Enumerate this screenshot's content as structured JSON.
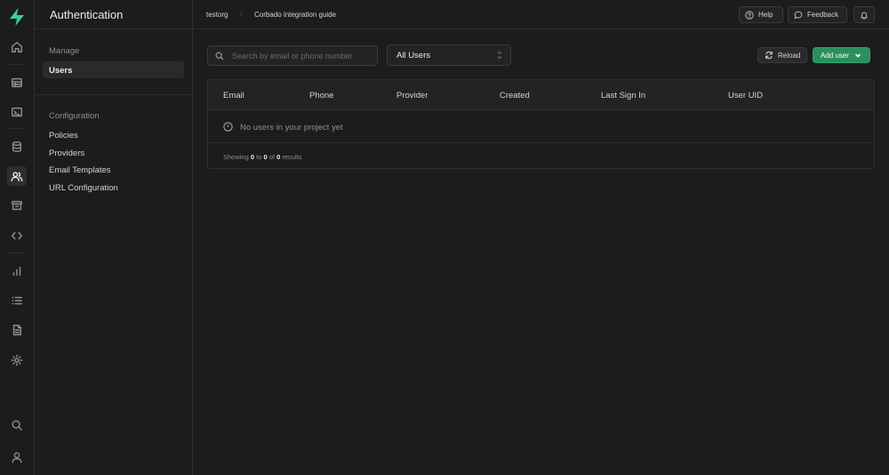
{
  "colors": {
    "brand": "#3ecf8e",
    "background": "#1c1c1c",
    "border": "#2e2e2e",
    "add_button": "#2b8f5e"
  },
  "rail": {
    "logo": "supabase-logo",
    "icons": [
      "home-icon",
      "table-editor-icon",
      "sql-editor-icon",
      "database-icon",
      "authentication-icon",
      "storage-icon",
      "edge-functions-icon",
      "reports-icon",
      "logs-icon",
      "api-docs-icon",
      "settings-icon",
      "search-icon",
      "user-icon"
    ],
    "active": "authentication-icon"
  },
  "menu": {
    "title": "Authentication",
    "sections": [
      {
        "title": "Manage",
        "items": [
          "Users"
        ]
      },
      {
        "title": "Configuration",
        "items": [
          "Policies",
          "Providers",
          "Email Templates",
          "URL Configuration"
        ]
      }
    ],
    "active_item": "Users"
  },
  "breadcrumb": {
    "org": "testorg",
    "separator": "/",
    "project": "Corbado integration guide"
  },
  "topbar": {
    "help_label": "Help",
    "feedback_label": "Feedback"
  },
  "toolbar": {
    "search_placeholder": "Search by email or phone number",
    "filter_value": "All Users",
    "reload_label": "Reload",
    "add_user_label": "Add user"
  },
  "table": {
    "columns": [
      "Email",
      "Phone",
      "Provider",
      "Created",
      "Last Sign In",
      "User UID"
    ],
    "empty_message": "No users in your project yet",
    "footer": {
      "prefix": "Showing",
      "from": "0",
      "to_word": "to",
      "to": "0",
      "of_word": "of",
      "total": "0",
      "suffix": "results"
    }
  }
}
